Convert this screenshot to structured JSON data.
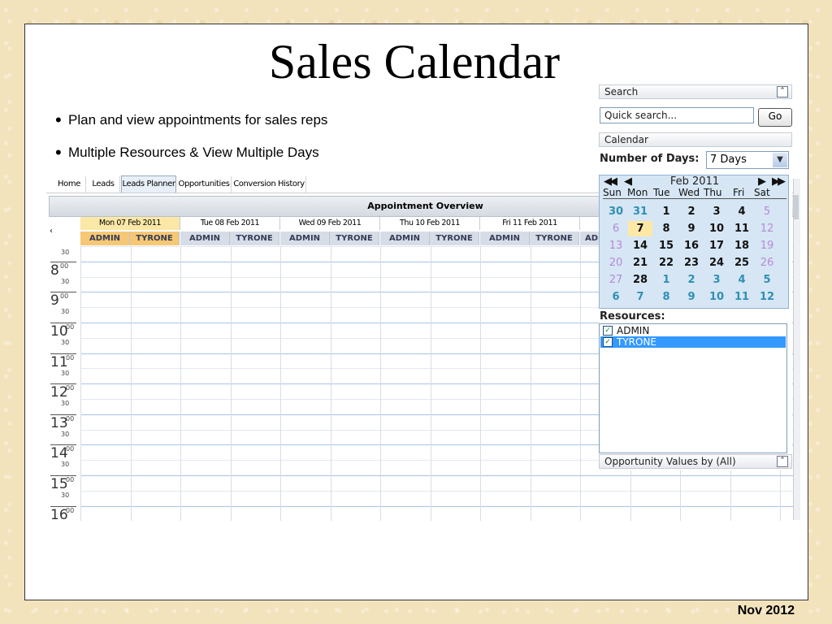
{
  "slide": {
    "title": "Sales Calendar",
    "bullets": [
      "Plan and view  appointments for sales reps",
      "Multiple Resources &   View Multiple Days"
    ],
    "footer": "Nov 2012"
  },
  "app": {
    "tabs": [
      {
        "label": "Home",
        "active": false
      },
      {
        "label": "Leads",
        "active": false
      },
      {
        "label": "Leads Planner",
        "active": true
      },
      {
        "label": "Opportunities",
        "active": false
      },
      {
        "label": "Conversion History",
        "active": false
      }
    ],
    "overview_title": "Appointment Overview",
    "nav_left": "‹",
    "days": [
      "Mon 07 Feb 2011",
      "Tue 08 Feb 2011",
      "Wed 09 Feb 2011",
      "Thu 10 Feb 2011",
      "Fri 11 Feb 2011"
    ],
    "resources_row": [
      "ADMIN",
      "TYRONE",
      "ADMIN",
      "TYRONE",
      "ADMIN",
      "TYRONE",
      "ADMIN",
      "TYRONE",
      "ADMIN",
      "TYRONE",
      "AD"
    ],
    "times": {
      "first_half": "30",
      "hours": [
        "8",
        "9",
        "10",
        "11",
        "12",
        "13",
        "14",
        "15",
        "16"
      ],
      "zero": "00",
      "half": "30"
    }
  },
  "panel": {
    "search_header": "Search",
    "collapse_glyph": "⌃",
    "search_placeholder": "Quick search...",
    "go_label": "Go",
    "calendar_header": "Calendar",
    "num_days_label": "Number of Days:",
    "num_days_value": "7 Days",
    "cal_month": "Feb 2011",
    "cal_prev_year": "◀◀",
    "cal_prev": "◀",
    "cal_next": "▶",
    "cal_next_year": "▶▶",
    "dow": [
      "Sun",
      "Mon",
      "Tue",
      "Wed",
      "Thu",
      "Fri",
      "Sat"
    ],
    "weeks": [
      [
        "30",
        "31",
        "1",
        "2",
        "3",
        "4",
        "5"
      ],
      [
        "6",
        "7",
        "8",
        "9",
        "10",
        "11",
        "12"
      ],
      [
        "13",
        "14",
        "15",
        "16",
        "17",
        "18",
        "19"
      ],
      [
        "20",
        "21",
        "22",
        "23",
        "24",
        "25",
        "26"
      ],
      [
        "27",
        "28",
        "1",
        "2",
        "3",
        "4",
        "5"
      ],
      [
        "6",
        "7",
        "8",
        "9",
        "10",
        "11",
        "12"
      ]
    ],
    "selected_day": "7",
    "resources_label": "Resources:",
    "resources": [
      {
        "name": "ADMIN",
        "checked": true,
        "selected": false
      },
      {
        "name": "TYRONE",
        "checked": true,
        "selected": true
      }
    ],
    "opp_header": "Opportunity Values by (All)"
  },
  "colors": {
    "today_header": "#fbe7a6",
    "selected_resource": "#3399ff",
    "calendar_bg": "#d6e6f4"
  }
}
